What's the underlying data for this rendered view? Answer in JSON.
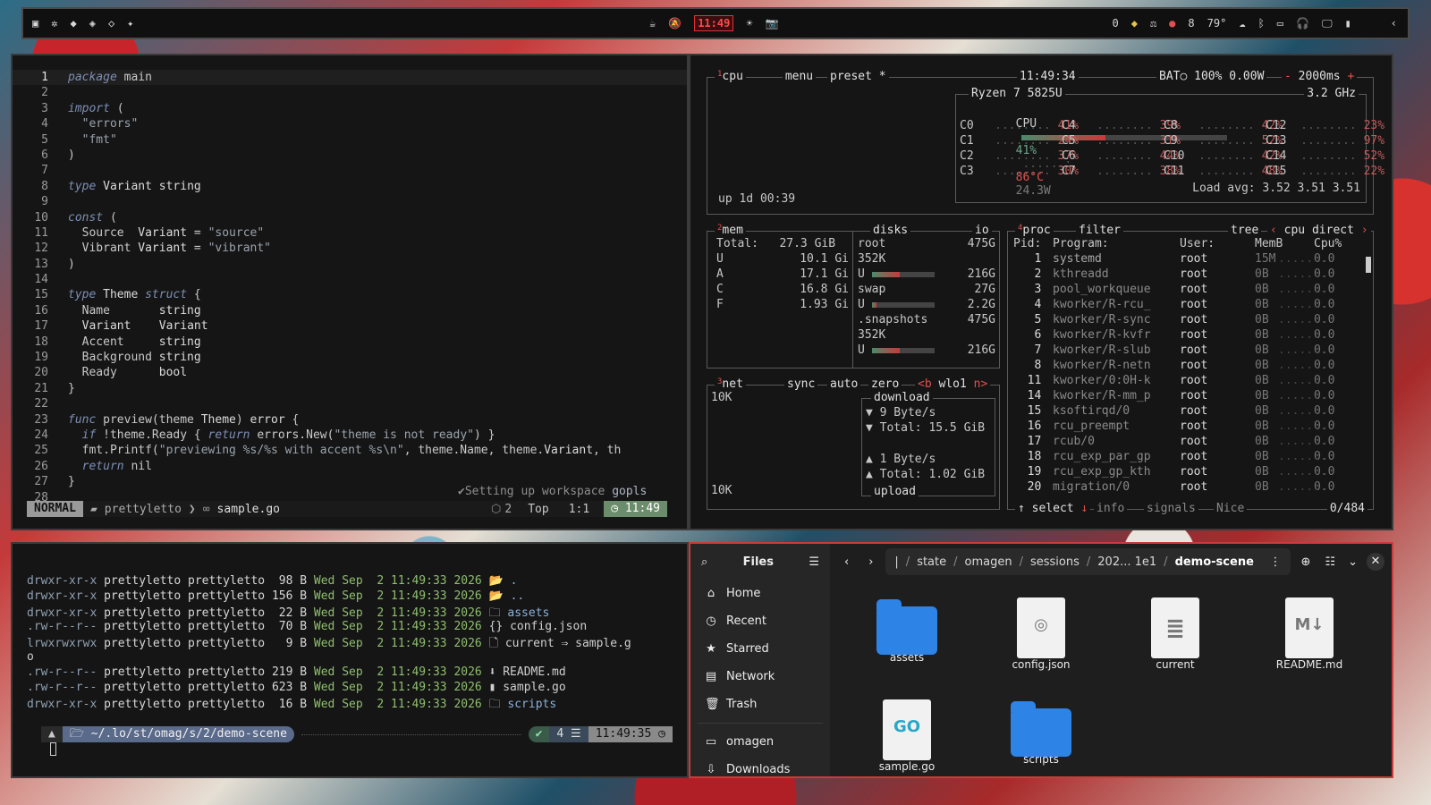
{
  "topbar": {
    "clock": "11:49",
    "status_temp": "79°",
    "status_count": "8",
    "status_zero": "0"
  },
  "editor": {
    "lines": [
      {
        "n": "1",
        "t": "package main"
      },
      {
        "n": "2",
        "t": ""
      },
      {
        "n": "3",
        "t": "import ("
      },
      {
        "n": "4",
        "t": "  \"errors\""
      },
      {
        "n": "5",
        "t": "  \"fmt\""
      },
      {
        "n": "6",
        "t": ")"
      },
      {
        "n": "7",
        "t": ""
      },
      {
        "n": "8",
        "t": "type Variant string"
      },
      {
        "n": "9",
        "t": ""
      },
      {
        "n": "10",
        "t": "const ("
      },
      {
        "n": "11",
        "t": "  Source  Variant = \"source\""
      },
      {
        "n": "12",
        "t": "  Vibrant Variant = \"vibrant\""
      },
      {
        "n": "13",
        "t": ")"
      },
      {
        "n": "14",
        "t": ""
      },
      {
        "n": "15",
        "t": "type Theme struct {"
      },
      {
        "n": "16",
        "t": "  Name       string"
      },
      {
        "n": "17",
        "t": "  Variant    Variant"
      },
      {
        "n": "18",
        "t": "  Accent     string"
      },
      {
        "n": "19",
        "t": "  Background string"
      },
      {
        "n": "20",
        "t": "  Ready      bool"
      },
      {
        "n": "21",
        "t": "}"
      },
      {
        "n": "22",
        "t": ""
      },
      {
        "n": "23",
        "t": "func preview(theme Theme) error {"
      },
      {
        "n": "24",
        "t": "  if !theme.Ready { return errors.New(\"theme is not ready\") }"
      },
      {
        "n": "25",
        "t": "  fmt.Printf(\"previewing %s/%s with accent %s\\n\", theme.Name, theme.Variant, th"
      },
      {
        "n": "26",
        "t": "  return nil"
      },
      {
        "n": "27",
        "t": "}"
      },
      {
        "n": "28",
        "t": ""
      }
    ],
    "lsp_message": "✔Setting up workspace",
    "lsp_name": "gopls",
    "status": {
      "mode": "NORMAL",
      "project": "prettyletto",
      "file": "sample.go",
      "diag": "2",
      "position": "Top",
      "cursor": "1:1",
      "time": "11:49"
    }
  },
  "btop": {
    "cpu": {
      "tab_num": "1",
      "title": "cpu",
      "menu": "menu",
      "preset": "preset *",
      "time": "11:49:34",
      "battery": "BAT○ 100% 0.00W",
      "interval": "2000ms",
      "model": "Ryzen 7 5825U",
      "freq": "3.2 GHz",
      "total_label": "CPU",
      "total_pct": "41%",
      "total_pct_value": 41,
      "temp": "86°C",
      "power": "24.3W",
      "cores": [
        {
          "name": "C0",
          "pct": "41%"
        },
        {
          "name": "C1",
          "pct": "24%"
        },
        {
          "name": "C2",
          "pct": "37%"
        },
        {
          "name": "C3",
          "pct": "30%"
        },
        {
          "name": "C4",
          "pct": "39%"
        },
        {
          "name": "C5",
          "pct": "31%"
        },
        {
          "name": "C6",
          "pct": "44%"
        },
        {
          "name": "C7",
          "pct": "38%"
        },
        {
          "name": "C8",
          "pct": "42%"
        },
        {
          "name": "C9",
          "pct": "52%"
        },
        {
          "name": "C10",
          "pct": "42%"
        },
        {
          "name": "C11",
          "pct": "48%"
        },
        {
          "name": "C12",
          "pct": "23%"
        },
        {
          "name": "C13",
          "pct": "97%"
        },
        {
          "name": "C14",
          "pct": "52%"
        },
        {
          "name": "C15",
          "pct": "22%"
        }
      ],
      "load_avg": "Load avg: 3.52 3.51 3.51",
      "uptime": "up 1d 00:39"
    },
    "mem": {
      "tab_num": "2",
      "title": "mem",
      "total_label": "Total:",
      "total": "27.3 GiB",
      "rows": [
        {
          "k": "U",
          "v": "10.1 Gi"
        },
        {
          "k": "A",
          "v": "17.1 Gi"
        },
        {
          "k": "C",
          "v": "16.8 Gi"
        },
        {
          "k": "F",
          "v": "1.93 Gi"
        }
      ]
    },
    "disks": {
      "title": "disks",
      "io": "io",
      "entries": [
        {
          "name": "root",
          "size": "475G",
          "io": "352K",
          "used": "216G",
          "fill": 45
        },
        {
          "name": "swap",
          "size": "27G",
          "io": "",
          "used": "2.2G",
          "fill": 8
        },
        {
          "name": ".snapshots",
          "size": "475G",
          "io": "352K",
          "used": "216G",
          "fill": 45
        }
      ]
    },
    "net": {
      "tab_num": "3",
      "title": "net",
      "sync": "sync",
      "auto": "auto",
      "zero": "zero",
      "iface_prev": "<b",
      "iface": "wlo1",
      "iface_next": "n>",
      "scale_top": "10K",
      "scale_bottom": "10K",
      "download_label": "download",
      "download_rate": "9 Byte/s",
      "download_total": "Total: 15.5 GiB",
      "upload_rate": "1 Byte/s",
      "upload_total": "Total: 1.02 GiB",
      "upload_label": "upload"
    },
    "proc": {
      "tab_num": "4",
      "title": "proc",
      "filter": "filter",
      "tree": "tree",
      "sort": "cpu direct",
      "columns": [
        "Pid:",
        "Program:",
        "User:",
        "MemB",
        "Cpu%"
      ],
      "rows": [
        {
          "pid": "1",
          "prog": "systemd",
          "user": "root",
          "mem": "15M",
          "cpu": "0.0"
        },
        {
          "pid": "2",
          "prog": "kthreadd",
          "user": "root",
          "mem": "0B",
          "cpu": "0.0"
        },
        {
          "pid": "3",
          "prog": "pool_workqueue",
          "user": "root",
          "mem": "0B",
          "cpu": "0.0"
        },
        {
          "pid": "4",
          "prog": "kworker/R-rcu_",
          "user": "root",
          "mem": "0B",
          "cpu": "0.0"
        },
        {
          "pid": "5",
          "prog": "kworker/R-sync",
          "user": "root",
          "mem": "0B",
          "cpu": "0.0"
        },
        {
          "pid": "6",
          "prog": "kworker/R-kvfr",
          "user": "root",
          "mem": "0B",
          "cpu": "0.0"
        },
        {
          "pid": "7",
          "prog": "kworker/R-slub",
          "user": "root",
          "mem": "0B",
          "cpu": "0.0"
        },
        {
          "pid": "8",
          "prog": "kworker/R-netn",
          "user": "root",
          "mem": "0B",
          "cpu": "0.0"
        },
        {
          "pid": "11",
          "prog": "kworker/0:0H-k",
          "user": "root",
          "mem": "0B",
          "cpu": "0.0"
        },
        {
          "pid": "14",
          "prog": "kworker/R-mm_p",
          "user": "root",
          "mem": "0B",
          "cpu": "0.0"
        },
        {
          "pid": "15",
          "prog": "ksoftirqd/0",
          "user": "root",
          "mem": "0B",
          "cpu": "0.0"
        },
        {
          "pid": "16",
          "prog": "rcu_preempt",
          "user": "root",
          "mem": "0B",
          "cpu": "0.0"
        },
        {
          "pid": "17",
          "prog": "rcub/0",
          "user": "root",
          "mem": "0B",
          "cpu": "0.0"
        },
        {
          "pid": "18",
          "prog": "rcu_exp_par_gp",
          "user": "root",
          "mem": "0B",
          "cpu": "0.0"
        },
        {
          "pid": "19",
          "prog": "rcu_exp_gp_kth",
          "user": "root",
          "mem": "0B",
          "cpu": "0.0"
        },
        {
          "pid": "20",
          "prog": "migration/0",
          "user": "root",
          "mem": "0B",
          "cpu": "0.0"
        }
      ],
      "footer_select": "select",
      "footer_info": "info",
      "footer_signals": "signals",
      "footer_nice": "Nice",
      "footer_count": "0/484"
    }
  },
  "terminal": {
    "lines": [
      {
        "perm": "drwxr-xr-x",
        "user": "prettyletto prettyletto",
        "size": " 98 B",
        "date": "Wed Sep  2 11:49:33 2026",
        "icon": "📂",
        "name": "."
      },
      {
        "perm": "drwxr-xr-x",
        "user": "prettyletto prettyletto",
        "size": "156 B",
        "date": "Wed Sep  2 11:49:33 2026",
        "icon": "📂",
        "name": ".."
      },
      {
        "perm": "drwxr-xr-x",
        "user": "prettyletto prettyletto",
        "size": " 22 B",
        "date": "Wed Sep  2 11:49:33 2026",
        "icon": "🗀",
        "name": "assets"
      },
      {
        "perm": ".rw-r--r--",
        "user": "prettyletto prettyletto",
        "size": " 70 B",
        "date": "Wed Sep  2 11:49:33 2026",
        "icon": "{}",
        "name": "config.json"
      },
      {
        "perm": "lrwxrwxrwx",
        "user": "prettyletto prettyletto",
        "size": "  9 B",
        "date": "Wed Sep  2 11:49:33 2026",
        "icon": "🗋",
        "name": "current ⇒ sample.g"
      },
      {
        "perm": "",
        "user": "",
        "size": "",
        "date": "",
        "icon": "",
        "name": "o"
      },
      {
        "perm": ".rw-r--r--",
        "user": "prettyletto prettyletto",
        "size": "219 B",
        "date": "Wed Sep  2 11:49:33 2026",
        "icon": "⬇",
        "name": "README.md"
      },
      {
        "perm": ".rw-r--r--",
        "user": "prettyletto prettyletto",
        "size": "623 B",
        "date": "Wed Sep  2 11:49:33 2026",
        "icon": "▮",
        "name": "sample.go"
      },
      {
        "perm": "drwxr-xr-x",
        "user": "prettyletto prettyletto",
        "size": " 16 B",
        "date": "Wed Sep  2 11:49:33 2026",
        "icon": "🗀",
        "name": "scripts"
      }
    ],
    "prompt_path": "~/.lo/st/omag/s/2/demo-scene",
    "prompt_jobs": "4",
    "prompt_time": "11:49:35"
  },
  "files": {
    "app_title": "Files",
    "sidebar": [
      {
        "icon": "home-icon",
        "glyph": "⌂",
        "label": "Home"
      },
      {
        "icon": "recent-icon",
        "glyph": "◷",
        "label": "Recent"
      },
      {
        "icon": "star-icon",
        "glyph": "★",
        "label": "Starred"
      },
      {
        "icon": "network-icon",
        "glyph": "▤",
        "label": "Network"
      },
      {
        "icon": "trash-icon",
        "glyph": "🗑",
        "label": "Trash"
      },
      {
        "icon": "folder-icon",
        "glyph": "▭",
        "label": "omagen"
      },
      {
        "icon": "download-icon",
        "glyph": "⇩",
        "label": "Downloads"
      }
    ],
    "breadcrumbs": [
      "state",
      "omagen",
      "sessions",
      "202... 1e1",
      "demo-scene"
    ],
    "items": [
      {
        "name": "assets",
        "kind": "folder"
      },
      {
        "name": "config.json",
        "kind": "json"
      },
      {
        "name": "current",
        "kind": "text"
      },
      {
        "name": "README.md",
        "kind": "md"
      },
      {
        "name": "sample.go",
        "kind": "go"
      },
      {
        "name": "scripts",
        "kind": "folder"
      }
    ],
    "colors": {
      "folder": "#2e83e6",
      "accent": "#cc3b3b"
    }
  }
}
